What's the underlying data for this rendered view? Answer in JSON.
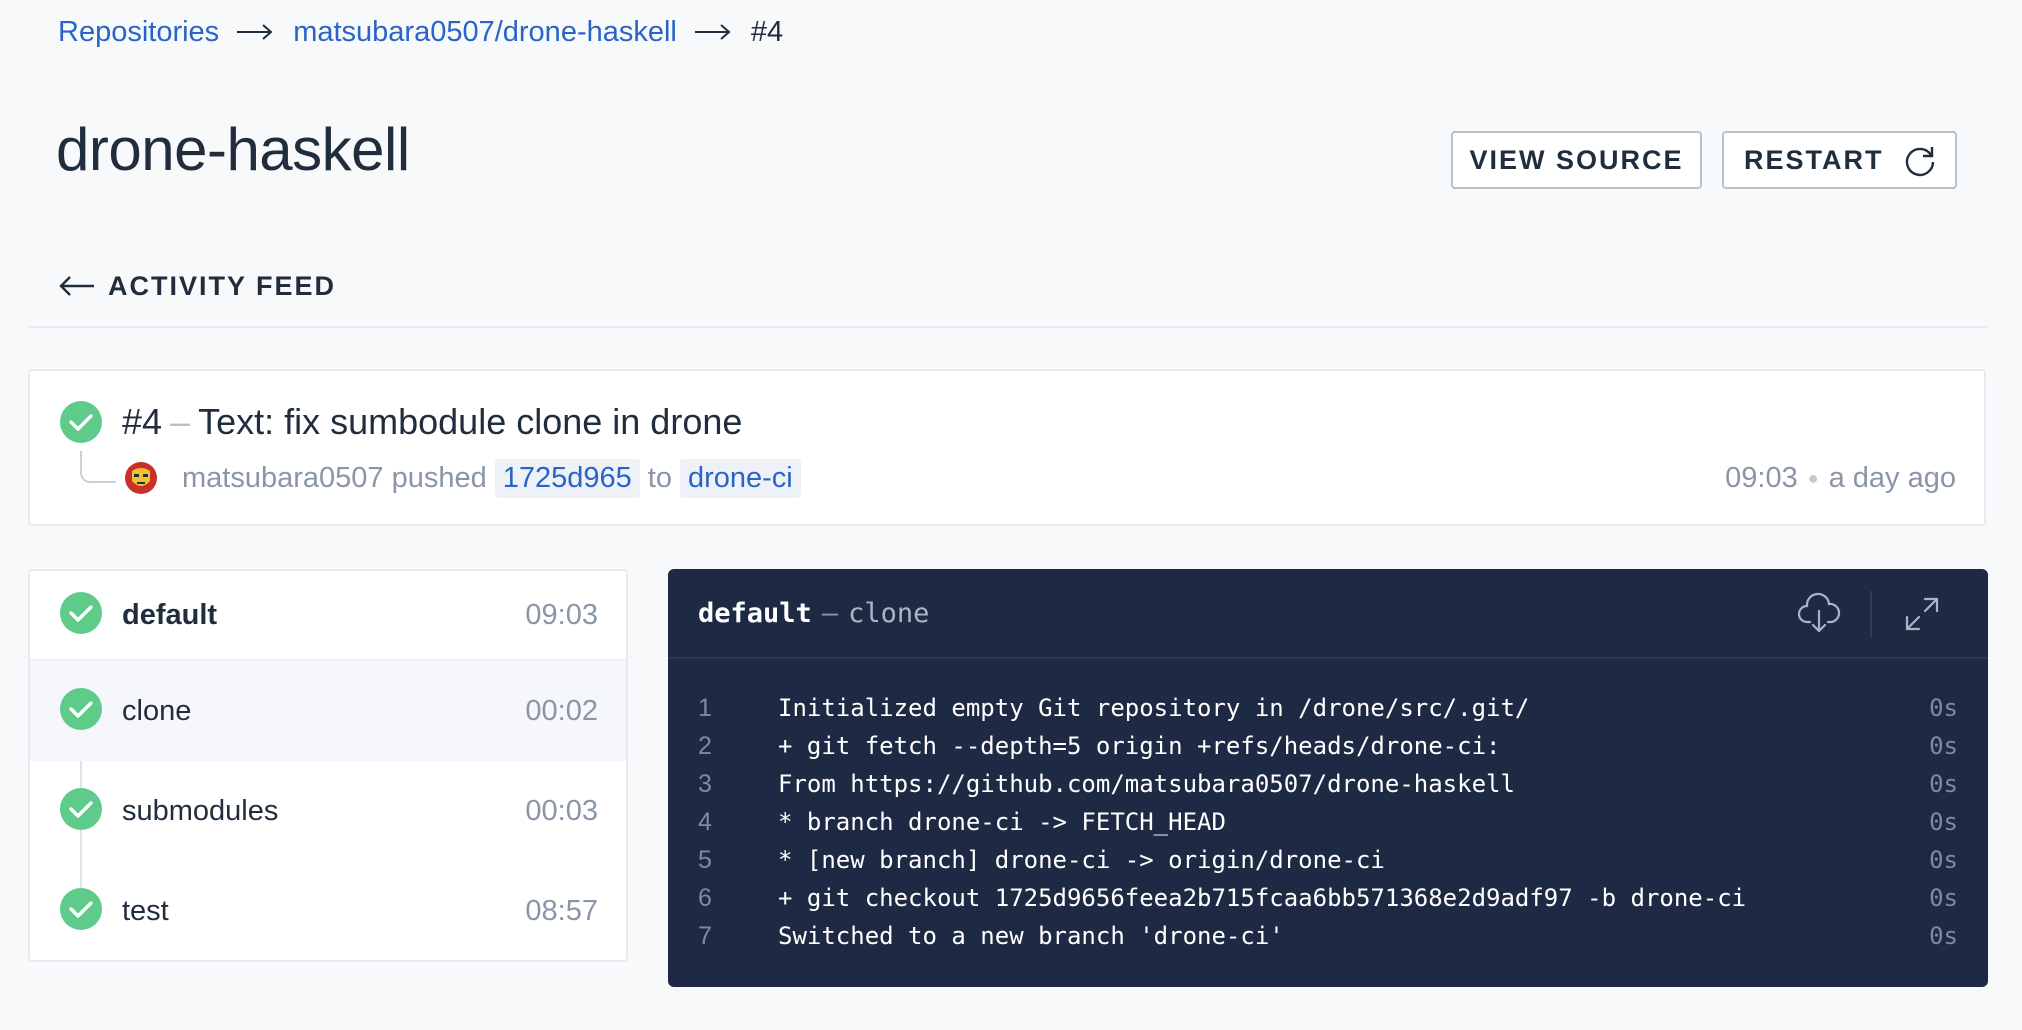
{
  "breadcrumb": {
    "repositories": "Repositories",
    "repo": "matsubara0507/drone-haskell",
    "current": "#4"
  },
  "header": {
    "title": "drone-haskell",
    "view_source_label": "VIEW SOURCE",
    "restart_label": "RESTART"
  },
  "activity_feed_label": "ACTIVITY FEED",
  "build": {
    "number": "#4",
    "dash": "–",
    "message": "Text: fix sumbodule clone in drone",
    "author": "matsubara0507",
    "action": "pushed",
    "commit": "1725d965",
    "to": "to",
    "branch": "drone-ci",
    "time": "09:03",
    "ago": "a day ago",
    "status": "success",
    "status_color": "#5ecb8a"
  },
  "steps": [
    {
      "name": "default",
      "time": "09:03",
      "status": "success"
    },
    {
      "name": "clone",
      "time": "00:02",
      "status": "success",
      "selected": true
    },
    {
      "name": "submodules",
      "time": "00:03",
      "status": "success"
    },
    {
      "name": "test",
      "time": "08:57",
      "status": "success"
    }
  ],
  "log": {
    "stage": "default",
    "dash": "–",
    "step": "clone",
    "download_icon": "cloud-download-icon",
    "expand_icon": "expand-icon",
    "lines": [
      {
        "n": "1",
        "text": "Initialized empty Git repository in /drone/src/.git/",
        "dur": "0s"
      },
      {
        "n": "2",
        "text": "+ git fetch --depth=5 origin +refs/heads/drone-ci:",
        "dur": "0s"
      },
      {
        "n": "3",
        "text": "From https://github.com/matsubara0507/drone-haskell",
        "dur": "0s"
      },
      {
        "n": "4",
        "text": "* branch drone-ci -> FETCH_HEAD",
        "dur": "0s"
      },
      {
        "n": "5",
        "text": "* [new branch] drone-ci -> origin/drone-ci",
        "dur": "0s"
      },
      {
        "n": "6",
        "text": "+ git checkout 1725d9656feea2b715fcaa6bb571368e2d9adf97 -b drone-ci",
        "dur": "0s"
      },
      {
        "n": "7",
        "text": "Switched to a new branch 'drone-ci'",
        "dur": "0s"
      }
    ]
  },
  "colors": {
    "link": "#2964c6",
    "success": "#5ecb8a",
    "log_bg": "#1e2a44",
    "muted": "#8a96a8"
  }
}
